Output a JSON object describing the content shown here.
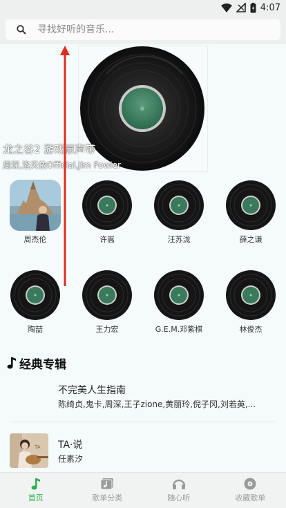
{
  "status_bar": {
    "time": "4:07"
  },
  "search": {
    "placeholder": "寻找好听的音乐..."
  },
  "hero": {
    "title": "龙之谷2 游戏原声带",
    "artists": "周深,洛天依Official,Jim Fowler"
  },
  "artists": [
    {
      "name": "周杰伦"
    },
    {
      "name": "许嵩"
    },
    {
      "name": "汪苏泷"
    },
    {
      "name": "薛之谦"
    },
    {
      "name": "陶喆"
    },
    {
      "name": "王力宏"
    },
    {
      "name": "G.E.M.邓紫棋"
    },
    {
      "name": "林俊杰"
    }
  ],
  "section": {
    "title": "经典专辑"
  },
  "albums": [
    {
      "name": "不完美人生指南",
      "artists": "陈绮贞,鬼卡,周深,王子zione,黄丽玲,倪子冈,刘若英,..."
    },
    {
      "name": "TA·说",
      "artists": "任素汐"
    }
  ],
  "nav": [
    {
      "label": "首页",
      "icon": "music-note-icon",
      "active": true
    },
    {
      "label": "歌单分类",
      "icon": "playlist-icon",
      "active": false
    },
    {
      "label": "随心听",
      "icon": "headphones-icon",
      "active": false
    },
    {
      "label": "收藏歌单",
      "icon": "disc-icon",
      "active": false
    }
  ],
  "colors": {
    "accent": "#2bb152",
    "arrow": "#e02b20",
    "disc_label": "#3a7a5c"
  }
}
